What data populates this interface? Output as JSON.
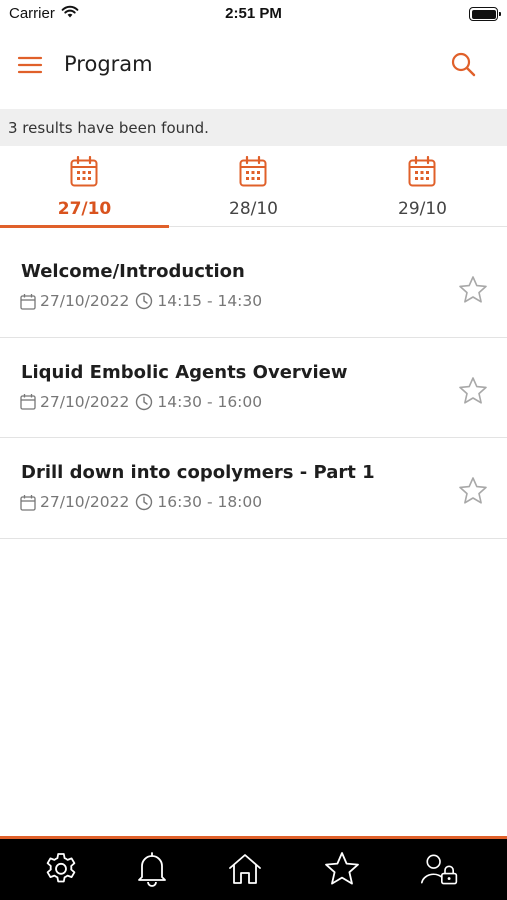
{
  "status_bar": {
    "carrier": "Carrier",
    "time": "2:51 PM",
    "icons": [
      "wifi-icon",
      "battery-icon"
    ]
  },
  "header": {
    "title": "Program",
    "menu_icon": "hamburger-menu-icon",
    "search_icon": "search-icon"
  },
  "results": {
    "text": "3 results have been found."
  },
  "day_tabs": [
    {
      "label": "27/10",
      "active": true,
      "icon": "calendar-icon"
    },
    {
      "label": "28/10",
      "active": false,
      "icon": "calendar-icon"
    },
    {
      "label": "29/10",
      "active": false,
      "icon": "calendar-icon"
    }
  ],
  "sessions": [
    {
      "title": "Welcome/Introduction",
      "date": "27/10/2022",
      "time": "14:15 - 14:30",
      "favorite": false
    },
    {
      "title": "Liquid Embolic Agents Overview",
      "date": "27/10/2022",
      "time": "14:30 - 16:00",
      "favorite": false
    },
    {
      "title": "Drill down into copolymers - Part 1",
      "date": "27/10/2022",
      "time": "16:30 - 18:00",
      "favorite": false
    }
  ],
  "bottom_nav": [
    {
      "name": "settings",
      "icon": "gear-icon"
    },
    {
      "name": "notifications",
      "icon": "bell-icon"
    },
    {
      "name": "home",
      "icon": "home-icon"
    },
    {
      "name": "favorites",
      "icon": "star-icon"
    },
    {
      "name": "account",
      "icon": "user-lock-icon"
    }
  ],
  "colors": {
    "accent": "#e0602a",
    "active_tab_text": "#d9531e",
    "results_bar_bg": "#efefef",
    "bottom_nav_bg": "#000000",
    "meta_text": "#777777"
  }
}
